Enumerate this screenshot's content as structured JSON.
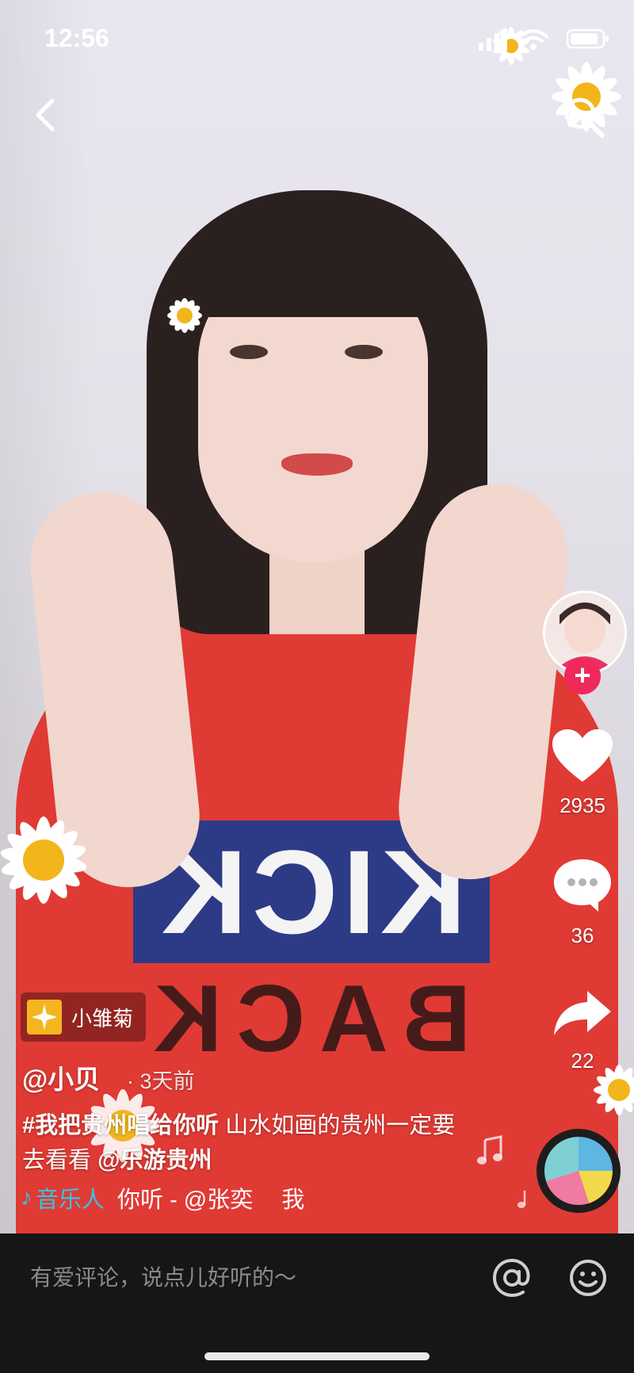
{
  "status_bar": {
    "time": "12:56"
  },
  "nav": {
    "back_icon": "chevron-left-icon",
    "search_icon": "search-icon"
  },
  "sticker": {
    "label": "小雏菊",
    "icon": "sparkle-sticker-icon"
  },
  "post": {
    "author": "@小贝",
    "time_ago": "· 3天前",
    "hashtag": "#我把贵州唱给你听",
    "caption": "山水如画的贵州一定要去看看",
    "mention": "@乐游贵州"
  },
  "music": {
    "label": "音乐人",
    "track": "你听 - @张奕",
    "track_cont": "我"
  },
  "actions": {
    "likes": "2935",
    "comments": "36",
    "shares": "22"
  },
  "follow_symbol": "+",
  "comment_bar": {
    "placeholder": "有爱评论，说点儿好听的～"
  },
  "shirt_print": {
    "line1": "KICK",
    "line2": "BACK"
  },
  "colors": {
    "accent_music": "#36c3e6",
    "follow_red": "#f0295b",
    "comment_bg": "#161616"
  }
}
